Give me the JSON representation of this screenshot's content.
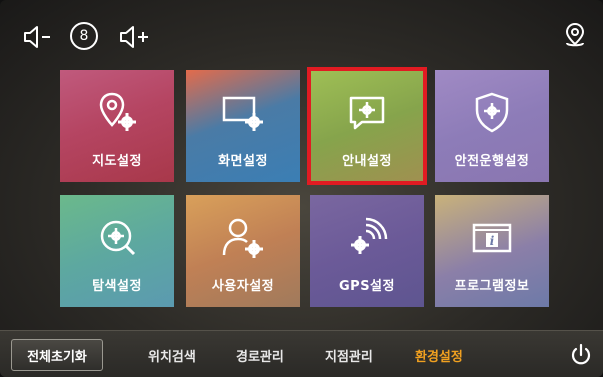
{
  "topbar": {
    "volume_level": "8",
    "icons": [
      "volume-down-icon",
      "volume-level-icon",
      "volume-up-icon",
      "location-pin-icon"
    ]
  },
  "tiles": [
    {
      "label": "지도설정",
      "icon": "map-pin-gear-icon"
    },
    {
      "label": "화면설정",
      "icon": "screen-gear-icon"
    },
    {
      "label": "안내설정",
      "icon": "speech-gear-icon",
      "selected": true
    },
    {
      "label": "안전운행설정",
      "icon": "shield-gear-icon"
    },
    {
      "label": "탐색설정",
      "icon": "search-gear-icon"
    },
    {
      "label": "사용자설정",
      "icon": "user-gear-icon"
    },
    {
      "label": "GPS설정",
      "icon": "gps-signal-icon"
    },
    {
      "label": "프로그램정보",
      "icon": "info-window-icon"
    }
  ],
  "bottombar": {
    "reset_label": "전체초기화",
    "nav": [
      {
        "label": "위치검색",
        "active": false
      },
      {
        "label": "경로관리",
        "active": false
      },
      {
        "label": "지점관리",
        "active": false
      },
      {
        "label": "환경설정",
        "active": true
      }
    ]
  },
  "colors": {
    "active_nav": "#f0a020",
    "selected_outline": "#e11b22"
  }
}
